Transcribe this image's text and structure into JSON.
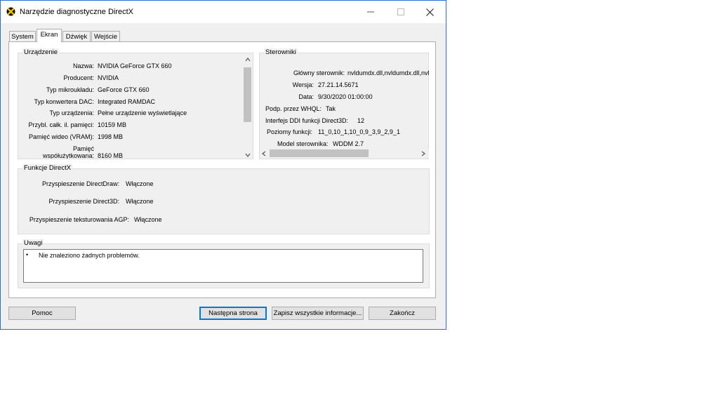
{
  "window": {
    "title": "Narzędzie diagnostyczne DirectX"
  },
  "tabs": [
    {
      "label": "System"
    },
    {
      "label": "Ekran",
      "active": true
    },
    {
      "label": "Dźwięk"
    },
    {
      "label": "Wejście"
    }
  ],
  "device": {
    "group_label": "Urządzenie",
    "rows": [
      {
        "label": "Nazwa:",
        "value": "NVIDIA GeForce GTX 660"
      },
      {
        "label": "Producent:",
        "value": "NVIDIA"
      },
      {
        "label": "Typ mikroukładu:",
        "value": "GeForce GTX 660"
      },
      {
        "label": "Typ konwertera DAC:",
        "value": "Integrated RAMDAC"
      },
      {
        "label": "Typ urządzenia:",
        "value": "Pełne urządzenie wyświetlające"
      },
      {
        "label": "Przybl. całk. il. pamięci:",
        "value": "10159 MB"
      },
      {
        "label": "Pamięć wideo (VRAM):",
        "value": "1998 MB"
      },
      {
        "label_line1": "Pamięć",
        "label_line2": "współużytkowana:",
        "value": "8160 MB"
      }
    ]
  },
  "drivers": {
    "group_label": "Sterowniki",
    "rows": [
      {
        "label": "Główny sterownik:",
        "value": "nvldumdx.dll,nvldumdx.dll,nvldumc"
      },
      {
        "label": "Wersja:",
        "value": "27.21.14.5671"
      },
      {
        "label": "Data:",
        "value": "9/30/2020 01:00:00"
      },
      {
        "label": "Podp. przez WHQL:",
        "value": "Tak"
      },
      {
        "label": "Interfejs DDI funkcji Direct3D:",
        "value": "12"
      },
      {
        "label": "Poziomy funkcji:",
        "value": "11_0,10_1,10_0,9_3,9_2,9_1"
      },
      {
        "label": "Model sterownika:",
        "value": "WDDM 2.7"
      }
    ]
  },
  "directx": {
    "group_label": "Funkcje DirectX",
    "rows": [
      {
        "label": "Przyspieszenie DirectDraw:",
        "value": "Włączone"
      },
      {
        "label": "Przyspieszenie Direct3D:",
        "value": "Włączone"
      },
      {
        "label": "Przyspieszenie teksturowania AGP:",
        "value": "Włączone"
      }
    ]
  },
  "notes": {
    "group_label": "Uwagi",
    "bullet": "•",
    "text": "Nie znaleziono żadnych problemów."
  },
  "buttons": {
    "help": "Pomoc",
    "next": "Następna strona",
    "save": "Zapisz wszystkie informacje...",
    "exit": "Zakończ"
  }
}
